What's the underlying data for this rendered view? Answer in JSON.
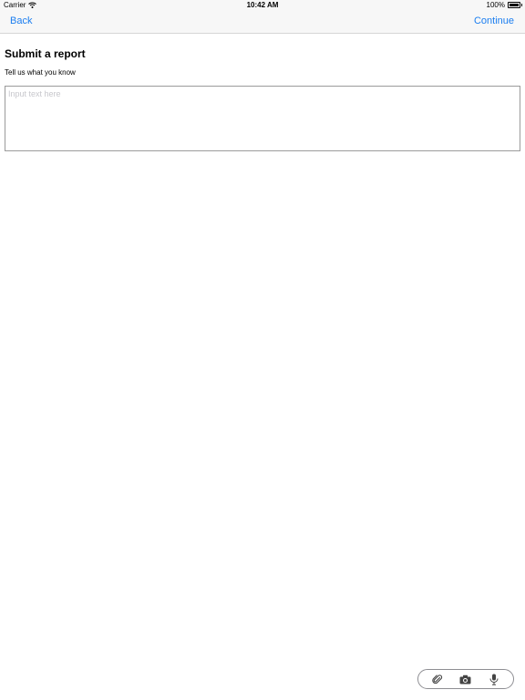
{
  "status_bar": {
    "carrier": "Carrier",
    "time": "10:42 AM",
    "battery": "100%"
  },
  "nav": {
    "back_label": "Back",
    "continue_label": "Continue"
  },
  "form": {
    "title": "Submit a report",
    "prompt": "Tell us what you know",
    "input_value": "",
    "input_placeholder": "Input text here"
  },
  "toolbar": {
    "items": [
      "paperclip-icon",
      "camera-icon",
      "microphone-icon"
    ]
  },
  "colors": {
    "accent": "#1b7ef0",
    "nav_background": "#f7f7f7",
    "input_border": "#9b9b9b",
    "placeholder": "#c7c7cc"
  }
}
